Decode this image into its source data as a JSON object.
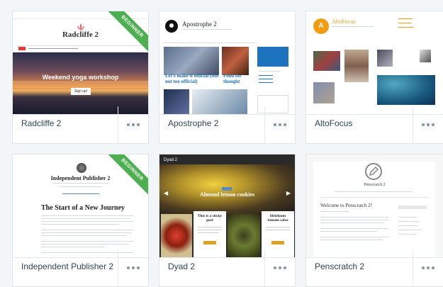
{
  "themes": [
    {
      "name": "Radcliffe 2",
      "badge": "BEGINNER",
      "preview": {
        "title": "Radcliffe 2",
        "hero_title": "Weekend yoga workshop",
        "hero_button": "Sign up!"
      }
    },
    {
      "name": "Apostrophe 2",
      "preview": {
        "title": "Apostrophe 2",
        "post1": "Let's make it official (but not too official)",
        "post2": "Food for thought"
      }
    },
    {
      "name": "AltoFocus",
      "preview": {
        "title": "AltoFocus"
      }
    },
    {
      "name": "Independent Publisher 2",
      "badge": "BEGINNER",
      "preview": {
        "title": "Independent Publisher 2",
        "heading": "The Start of a New Journey"
      }
    },
    {
      "name": "Dyad 2",
      "preview": {
        "title": "Dyad 2",
        "hero_title": "Almond lemon cookies",
        "card1": "This is a sticky post",
        "card2": "Heirloom tomato salsa"
      }
    },
    {
      "name": "Penscratch 2",
      "preview": {
        "title": "Penscratch 2",
        "heading": "Welcome to Penscratch 2!"
      }
    }
  ],
  "more_label": "•••",
  "colors": {
    "ribbon": "#4caf50",
    "text": "#2e4453",
    "dots": "#7f97a8",
    "apostrophe_blue": "#1e73be",
    "alto_orange": "#f39c12"
  }
}
